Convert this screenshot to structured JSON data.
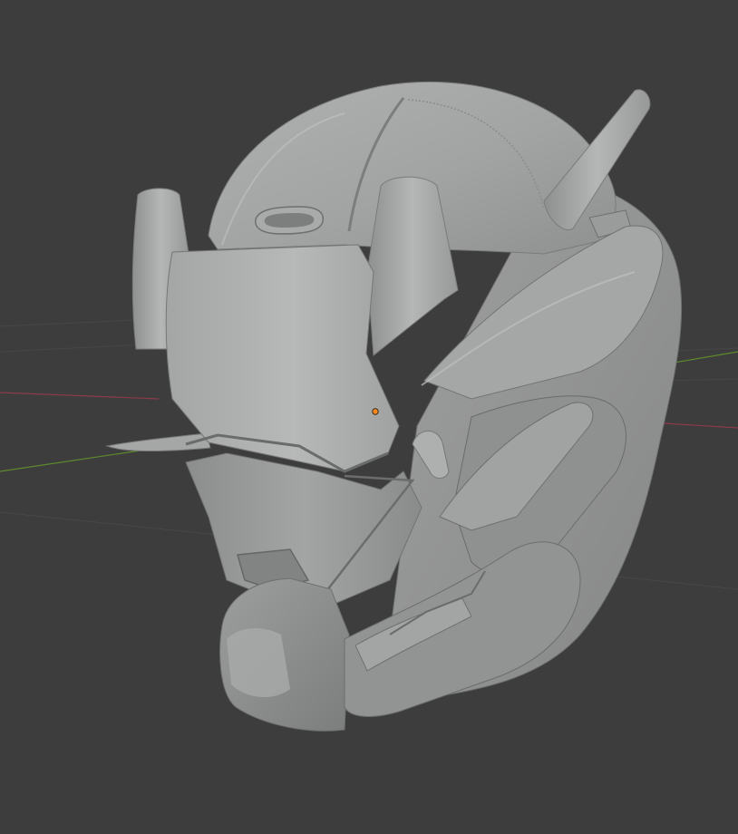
{
  "app": {
    "name": "3D Viewport",
    "background": "#3d3d3d"
  },
  "viewport": {
    "grid": {
      "visible": true,
      "x_axis_color": "#8b3b4b",
      "y_axis_color": "#5d8a2e",
      "line_color": "#474747"
    },
    "object": {
      "name": "helmet-mesh",
      "shading": "solid",
      "base_color": "#9a9b9b",
      "origin_color": "#ff8a1f"
    }
  }
}
